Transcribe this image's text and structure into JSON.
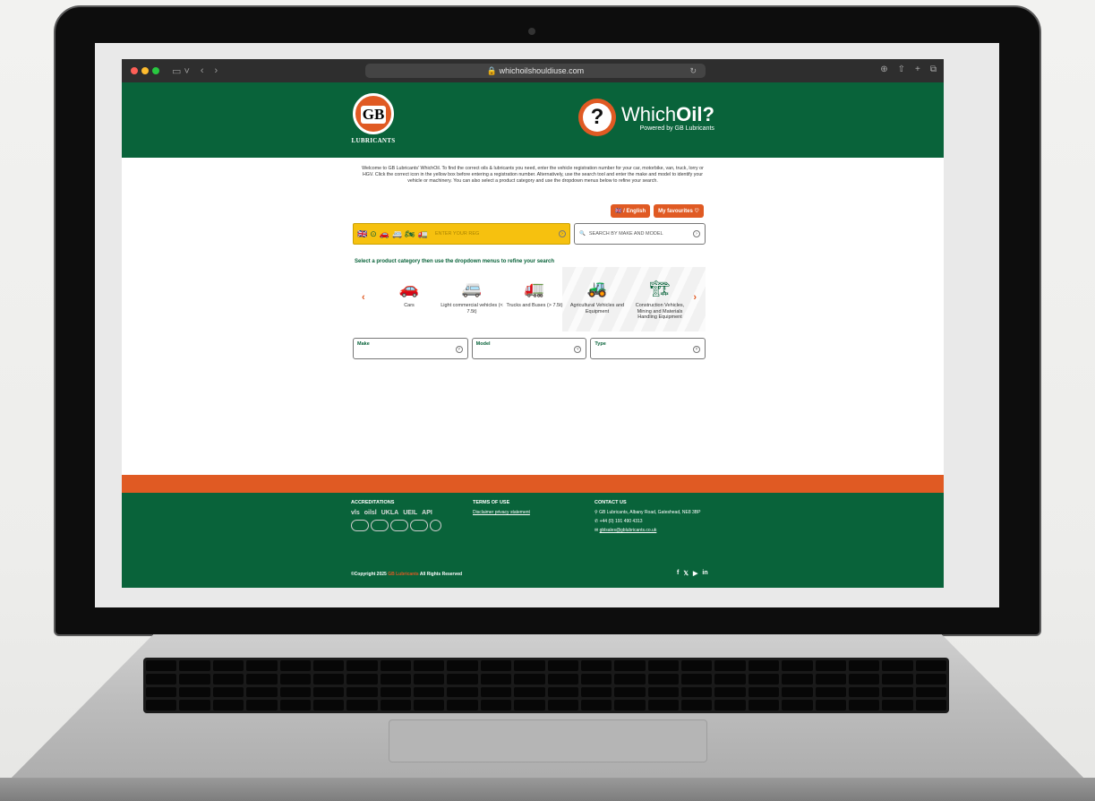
{
  "browser": {
    "url": "whichoilshouldiuse.com",
    "icons": [
      "sidebar-icon",
      "back-icon",
      "forward-icon",
      "lock-icon",
      "reload-icon",
      "download-icon",
      "share-icon",
      "new-tab-icon",
      "tabs-icon"
    ]
  },
  "header": {
    "gb_logo_text": "GB",
    "gb_logo_subtitle": "LUBRICANTS",
    "which_oil_prefix": "Which",
    "which_oil_bold": "Oil?",
    "which_oil_tagline": "Powered by GB Lubricants"
  },
  "welcome_text": "Welcome to GB Lubricants' WhichOil. To find the correct oils & lubricants you need, enter the vehicle registration number for your car, motorbike, van, truck, lorry or HGV. Click the correct icon in the yellow box before entering a registration number. Alternatively, use the search tool and enter the make and model to identify your vehicle or machinery. You can also select a product category and use the dropdown menus below to refine your search.",
  "language_button": "/ English",
  "favourites_button": "My favourites",
  "reg_search": {
    "placeholder": "ENTER YOUR REG"
  },
  "make_search": {
    "placeholder": "SEARCH BY MAKE AND MODEL"
  },
  "category_heading": "Select a product category then use the dropdown menus to refine your search",
  "categories": [
    {
      "label": "Cars",
      "icon": "car-icon"
    },
    {
      "label": "Light commercial vehicles (< 7.5t)",
      "icon": "van-icon"
    },
    {
      "label": "Trucks and Buses (> 7.5t)",
      "icon": "truck-icon"
    },
    {
      "label": "Agricultural Vehicles and Equipment",
      "icon": "tractor-icon"
    },
    {
      "label": "Construction Vehicles, Mining and Materials Handling Equipment",
      "icon": "forklift-icon"
    }
  ],
  "dropdowns": {
    "make": "Make",
    "model": "Model",
    "type": "Type"
  },
  "footer": {
    "accreditations_title": "ACCREDITATIONS",
    "accreditation_logos": [
      "vls",
      "oilsl",
      "UKLA",
      "UEIL",
      "API"
    ],
    "terms_title": "TERMS OF USE",
    "terms_link": "Disclaimer privacy statement",
    "contact_title": "CONTACT US",
    "address": "GB Lubricants, Albany Road, Gateshead, NE8 3BP",
    "phone": "+44 (0) 191 490 4313",
    "email": "gblsales@gblubricants.co.uk",
    "copyright_prefix": "©Copyright 2025",
    "copyright_brand": "GB Lubricants",
    "copyright_suffix": "All Rights Reserved",
    "social": [
      "facebook-icon",
      "x-icon",
      "youtube-icon",
      "linkedin-icon"
    ]
  },
  "colors": {
    "brand_green": "#09633a",
    "brand_orange": "#e05a23",
    "reg_yellow": "#f6c10f"
  }
}
